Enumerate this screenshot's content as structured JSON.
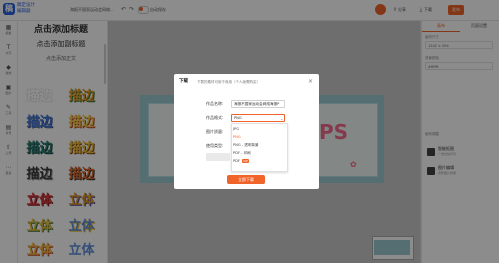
{
  "app": {
    "logo_text": "稿定设计\n编辑器",
    "title": "海报不国家运动会网络..."
  },
  "topbar": {
    "toggle_label": "自动保存",
    "buttons": [
      {
        "label": "分享"
      },
      {
        "label": "下载"
      },
      {
        "label": "发布"
      }
    ]
  },
  "rail": {
    "items": [
      "模板",
      "文字",
      "素材",
      "图片",
      "工具",
      "背景",
      "上传",
      "更多"
    ]
  },
  "left_panel": {
    "add_title": "点击添加标题",
    "add_subtitle": "点击添加副标题",
    "add_body": "点击添加正文",
    "styles": [
      {
        "text": "描边",
        "color": "#1a1a1a",
        "stroke": "#ffffff"
      },
      {
        "text": "描边",
        "color": "#e8a126",
        "stroke": "#2f6d3a"
      },
      {
        "text": "描边",
        "color": "#3b6fd0",
        "stroke": "#ffffff"
      },
      {
        "text": "描边",
        "color": "#f3d24b",
        "stroke": "#c0392b"
      },
      {
        "text": "描边",
        "color": "#2d7d73",
        "stroke": "#ffffff"
      },
      {
        "text": "描边",
        "color": "#f1c23c",
        "stroke": "#7a3e13"
      },
      {
        "text": "描边",
        "color": "#3a3a3a",
        "stroke": "#d8d8d8"
      },
      {
        "text": "描边",
        "color": "#e26b2b",
        "stroke": "#2b2b2b"
      },
      {
        "text": "立体",
        "color": "#e0383d",
        "stroke": "#7a1a1c"
      },
      {
        "text": "立体",
        "color": "#e8a126",
        "stroke": "#4a3a8a"
      },
      {
        "text": "立体",
        "color": "#f1c23c",
        "stroke": "#2f6d3a"
      },
      {
        "text": "立体",
        "color": "#5b8fd9",
        "stroke": "#f1c23c"
      }
    ]
  },
  "canvas": {
    "deco_text": "PS"
  },
  "right_panel": {
    "tabs": [
      "画布",
      "页面设置"
    ],
    "labels": [
      "画布尺寸",
      "背景颜色",
      "画布调整"
    ],
    "box_values": [
      "1242 × 594",
      "#ffffff"
    ],
    "tools": [
      {
        "title": "智能抠图",
        "desc": "一键去除背景"
      },
      {
        "title": "图片编辑",
        "desc": "调整图片效果"
      }
    ]
  },
  "dialog": {
    "title": "下载",
    "tip": "下载的素材可用于商用（个人版需购买）",
    "close": "×",
    "fields": [
      {
        "label": "作品名称:",
        "value": "海报不国家运动会网络海报P"
      },
      {
        "label": "作品格式:",
        "value": "PNG"
      },
      {
        "label": "图片质量:",
        "value": ""
      },
      {
        "label": "使用类型:",
        "value": ""
      }
    ],
    "options": [
      {
        "label": "JPG",
        "vip": ""
      },
      {
        "label": "PNG",
        "vip": ""
      },
      {
        "label": "PNG - 透明背景",
        "vip": ""
      },
      {
        "label": "PDF - 印刷",
        "vip": ""
      },
      {
        "label": "PDF",
        "vip": "VIP"
      }
    ],
    "download_button": "立即下载"
  },
  "colors": {
    "accent": "#f0642a",
    "brand": "#2b5fe0",
    "canvas_bg": "#9cc8cf"
  }
}
